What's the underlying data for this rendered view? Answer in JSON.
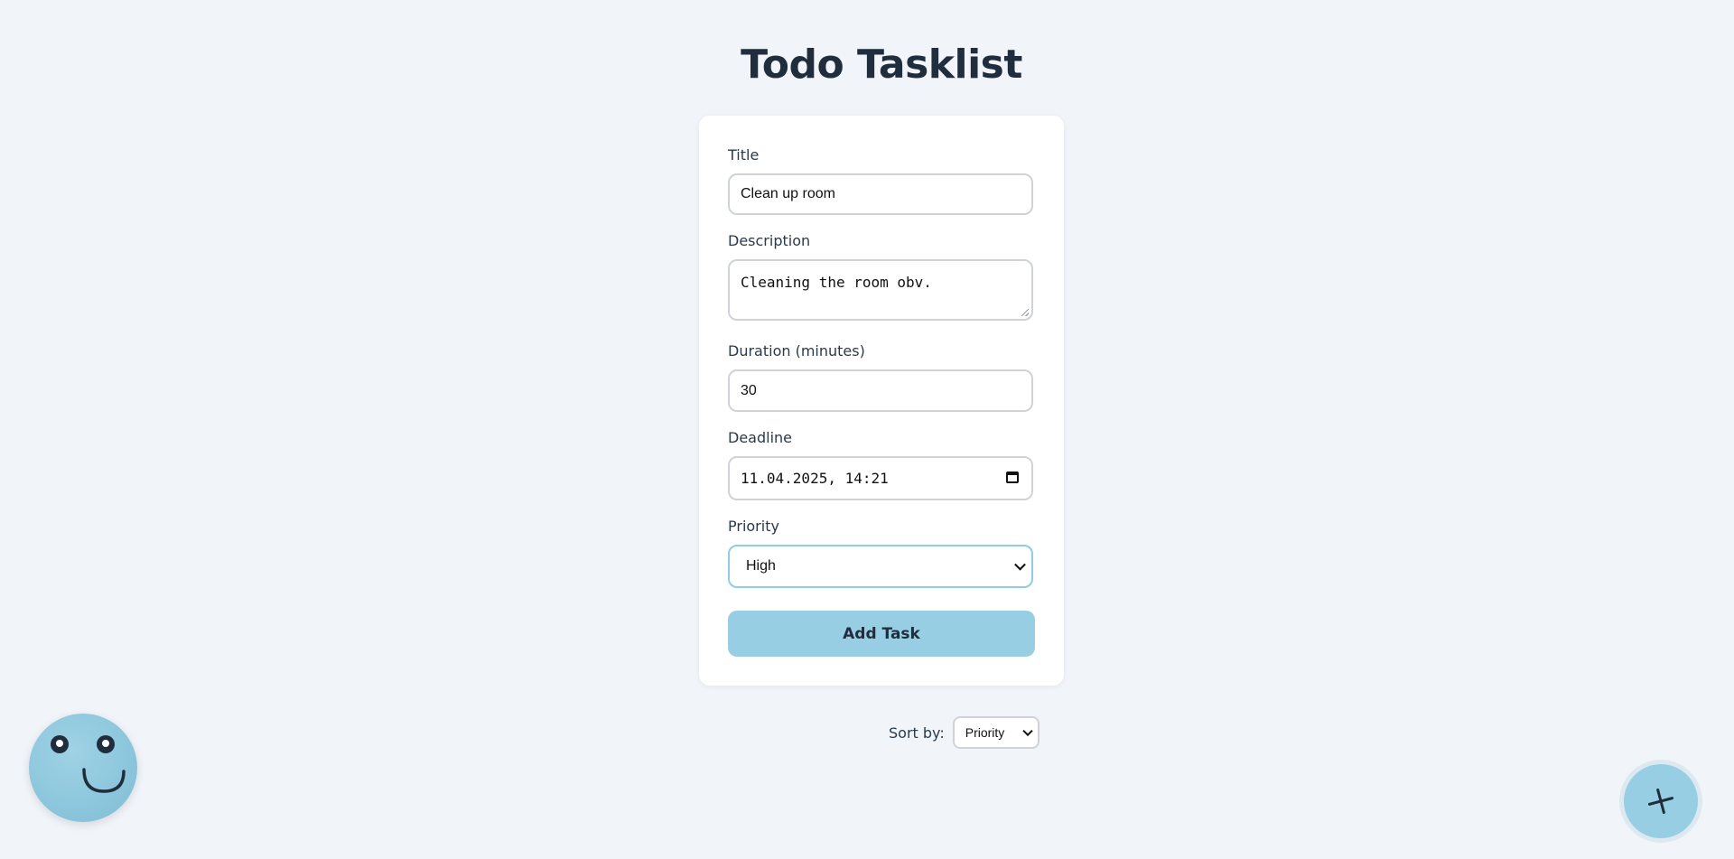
{
  "app": {
    "title": "Todo Tasklist"
  },
  "form": {
    "title_label": "Title",
    "title_value": "Clean up room",
    "description_label": "Description",
    "description_value": "Cleaning the room obv.",
    "duration_label": "Duration (minutes)",
    "duration_value": "30",
    "deadline_label": "Deadline",
    "deadline_value": "11.04.2025, 14:21",
    "priority_label": "Priority",
    "priority_value": "High",
    "submit_label": "Add Task"
  },
  "sort": {
    "label": "Sort by:",
    "value": "Priority"
  },
  "colors": {
    "background": "#f1f5fa",
    "accent": "#98cee3",
    "text": "#1f2d3d"
  },
  "icons": {
    "mascot": "smiley-face-icon",
    "fab": "plus-icon",
    "calendar": "calendar-icon"
  }
}
